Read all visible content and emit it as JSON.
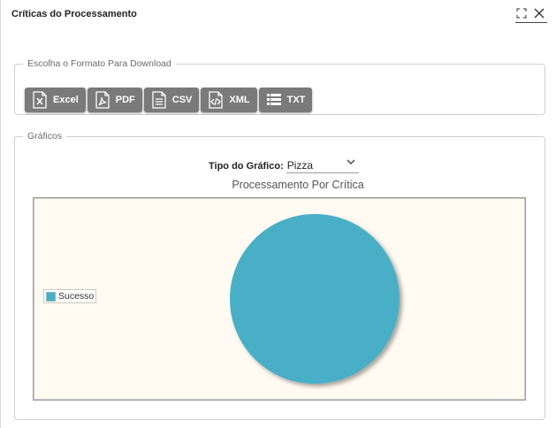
{
  "dialog": {
    "title": "Críticas do Processamento"
  },
  "downloads": {
    "legend": "Escolha o Formato Para Download",
    "buttons": [
      {
        "label": "Excel",
        "icon": "excel-icon"
      },
      {
        "label": "PDF",
        "icon": "pdf-icon"
      },
      {
        "label": "CSV",
        "icon": "csv-icon"
      },
      {
        "label": "XML",
        "icon": "xml-icon"
      },
      {
        "label": "TXT",
        "icon": "txt-icon"
      }
    ]
  },
  "charts": {
    "legend": "Gráficos",
    "chart_type_label": "Tipo do Gráfico:",
    "chart_type_value": "Pizza"
  },
  "colors": {
    "button_bg": "#7a7a7a",
    "plot_bg": "#fffbf2",
    "slice": "#4aafc6"
  },
  "chart_data": {
    "type": "pie",
    "title": "Processamento Por Crítica",
    "categories": [
      "Sucesso"
    ],
    "values": [
      100
    ],
    "legend_position": "left"
  }
}
